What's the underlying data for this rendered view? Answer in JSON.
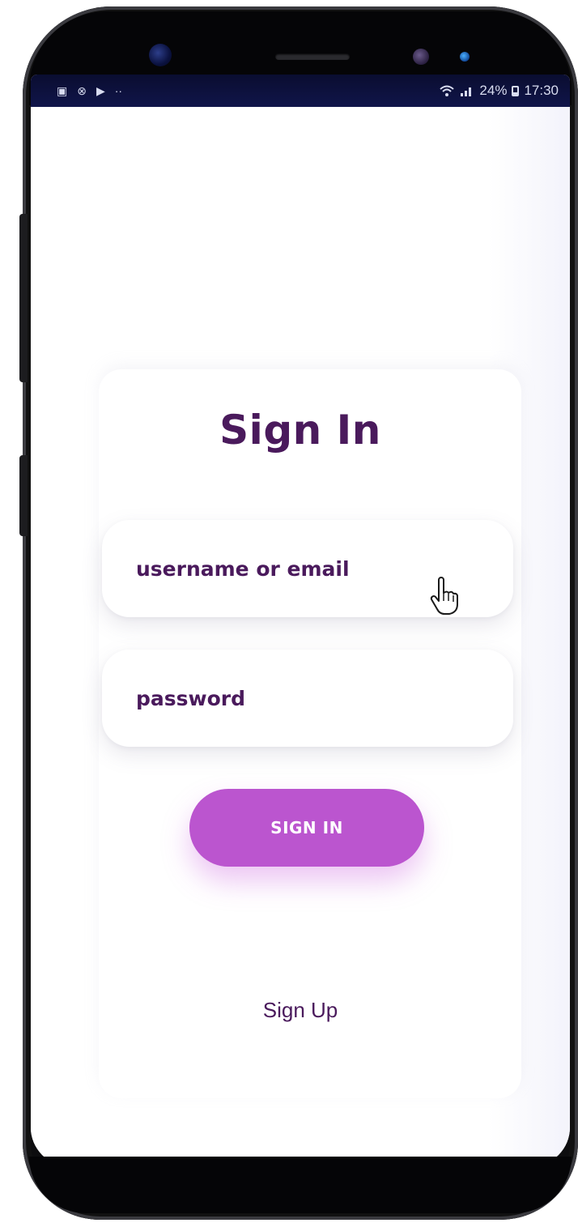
{
  "status_bar": {
    "left_icons": [
      "gallery-icon",
      "sync-icon",
      "play-store-icon",
      "more-dots-icon"
    ],
    "right_icons": [
      "wifi-icon",
      "signal-icon",
      "battery-icon"
    ],
    "battery_percent": "24%",
    "time": "17:30"
  },
  "signin": {
    "title": "Sign In",
    "username_placeholder": "username or email",
    "password_placeholder": "password",
    "button_label": "SIGN IN",
    "signup_link": "Sign Up"
  },
  "colors": {
    "accent": "#bb55cf",
    "text_primary": "#4a1a5c",
    "status_bar_bg": "#0a0d30"
  }
}
